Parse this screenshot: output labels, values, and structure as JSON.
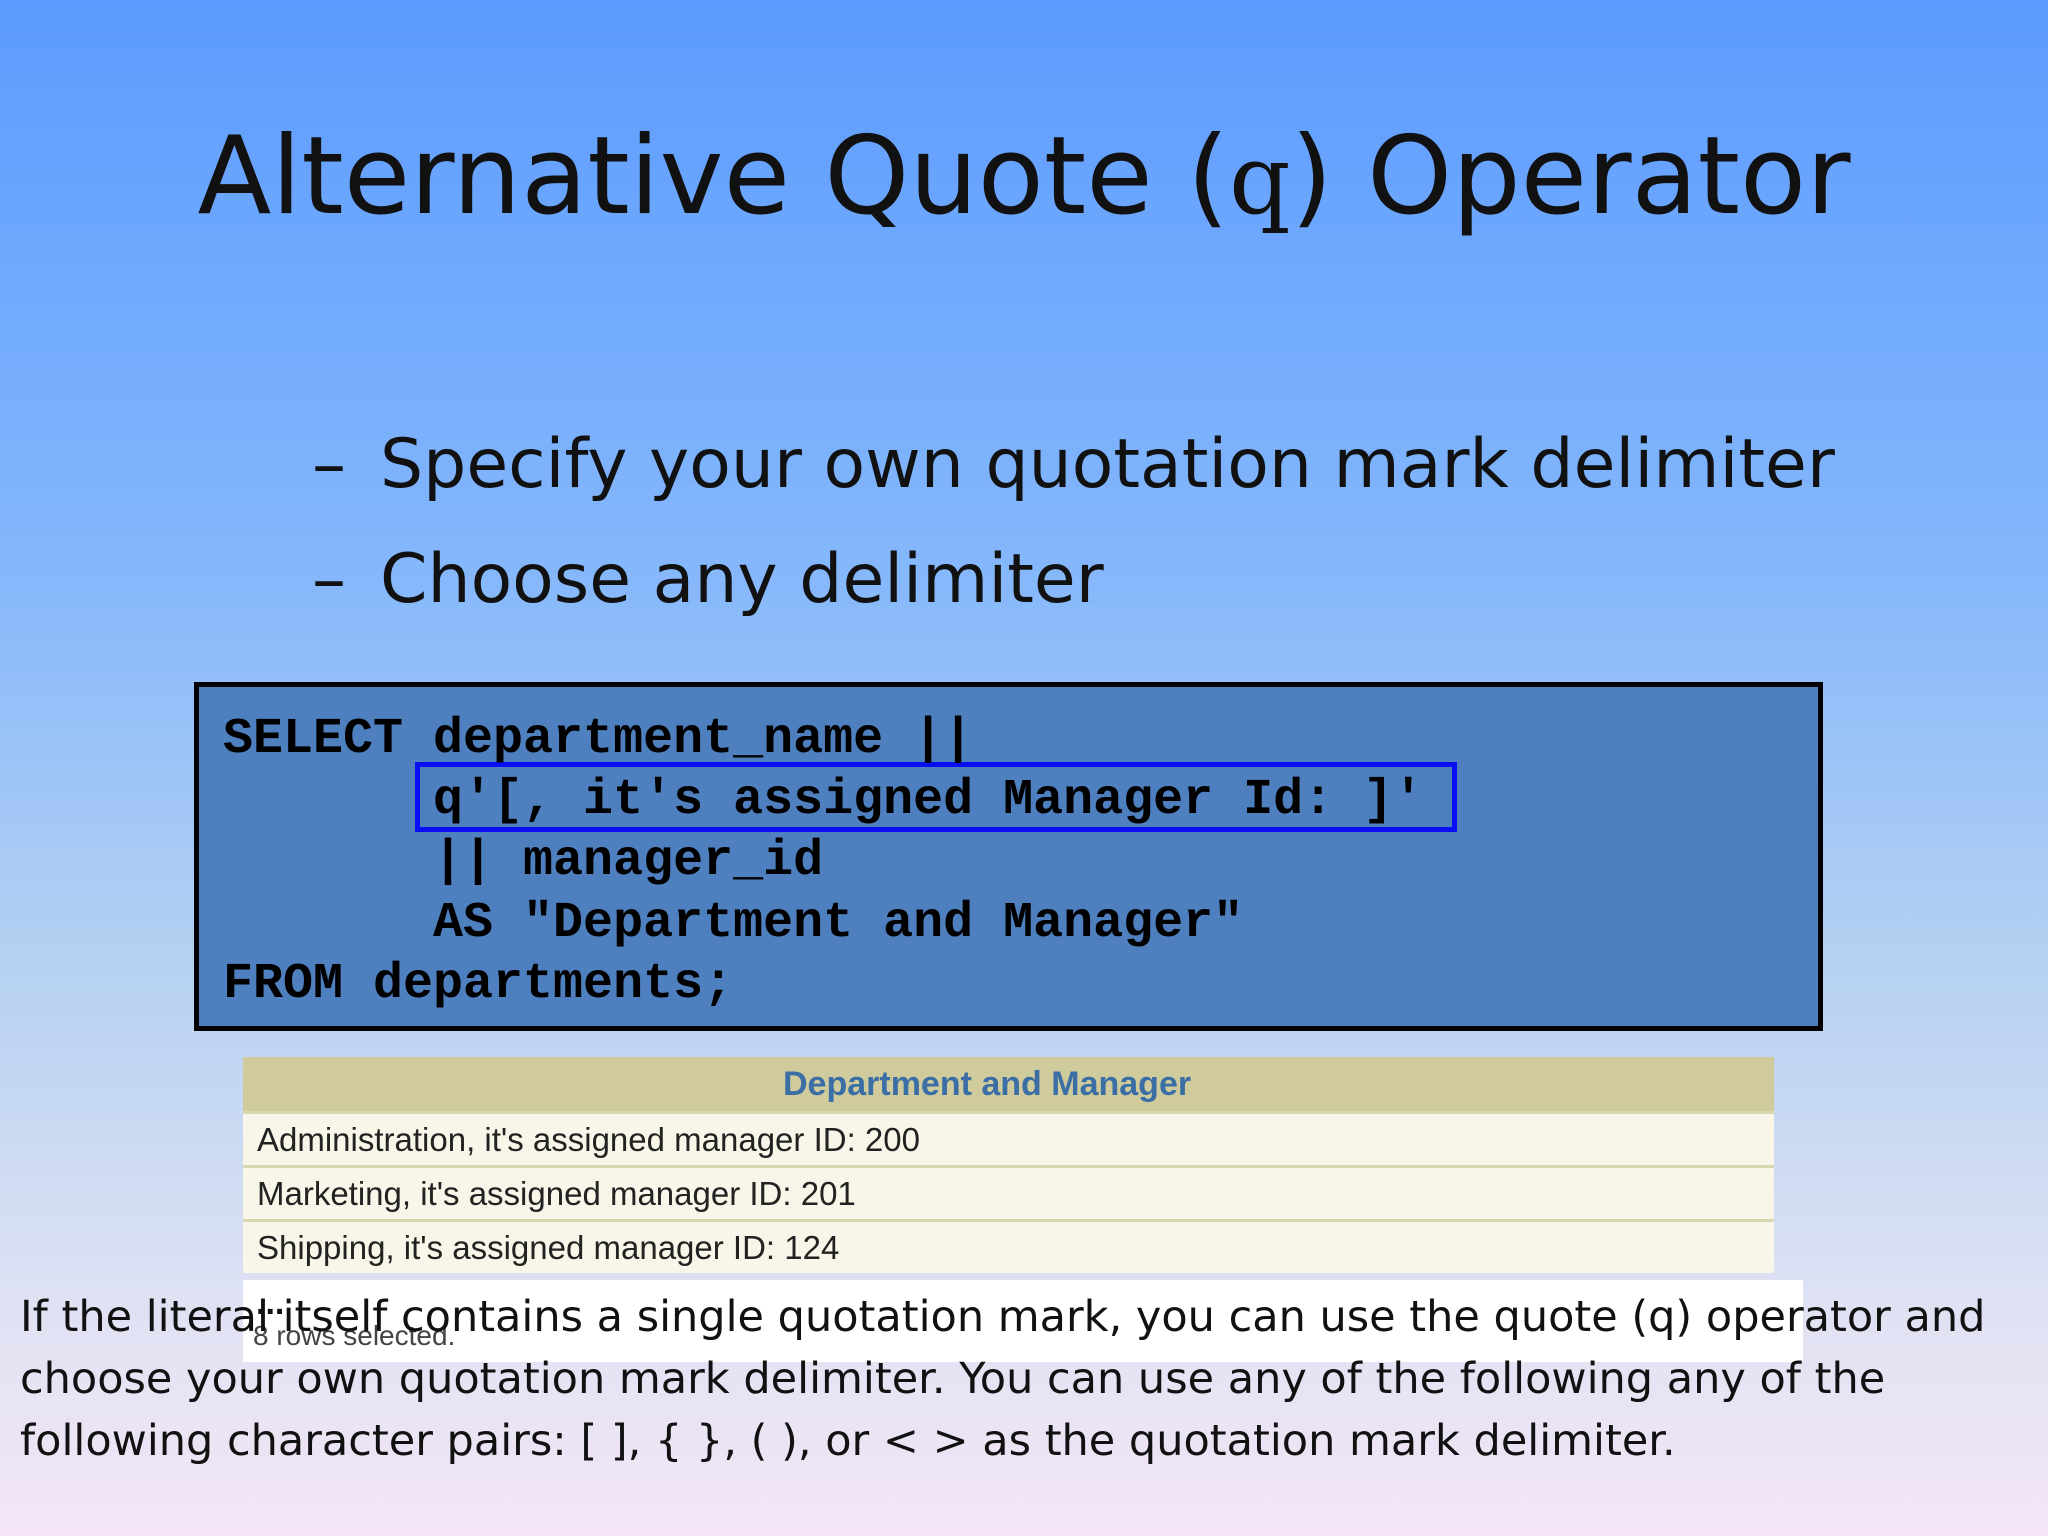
{
  "slide": {
    "title_before": "Alternative Quote (",
    "title_q": "q",
    "title_after": ") Operator"
  },
  "bullets": [
    {
      "dash": "–",
      "text": "Specify your own quotation mark delimiter"
    },
    {
      "dash": "–",
      "text": "Choose any delimiter"
    }
  ],
  "code": {
    "lines": [
      "SELECT department_name ||",
      "       q'[, it's assigned Manager Id: ]'",
      "       || manager_id",
      "       AS \"Department and Manager\"",
      "FROM departments;"
    ]
  },
  "result_table": {
    "header": "Department and Manager",
    "rows": [
      "Administration, it's assigned manager ID: 200",
      "Marketing, it's assigned manager ID: 201",
      "Shipping, it's assigned manager ID: 124"
    ],
    "ellipsis": "...",
    "footer": "8 rows selected."
  },
  "note": {
    "text": "If the literal itself contains a single quotation mark, you can use the quote (q) operator and choose your own quotation mark delimiter. You can use any of the following any of the following character pairs: [ ], { }, ( ), or < > as the quotation mark delimiter."
  },
  "colors": {
    "code_background": "#4e7fbf",
    "highlight_border": "#0a0ef5",
    "table_header_background": "#cfcb9c",
    "table_header_text": "#3a6ea5"
  }
}
